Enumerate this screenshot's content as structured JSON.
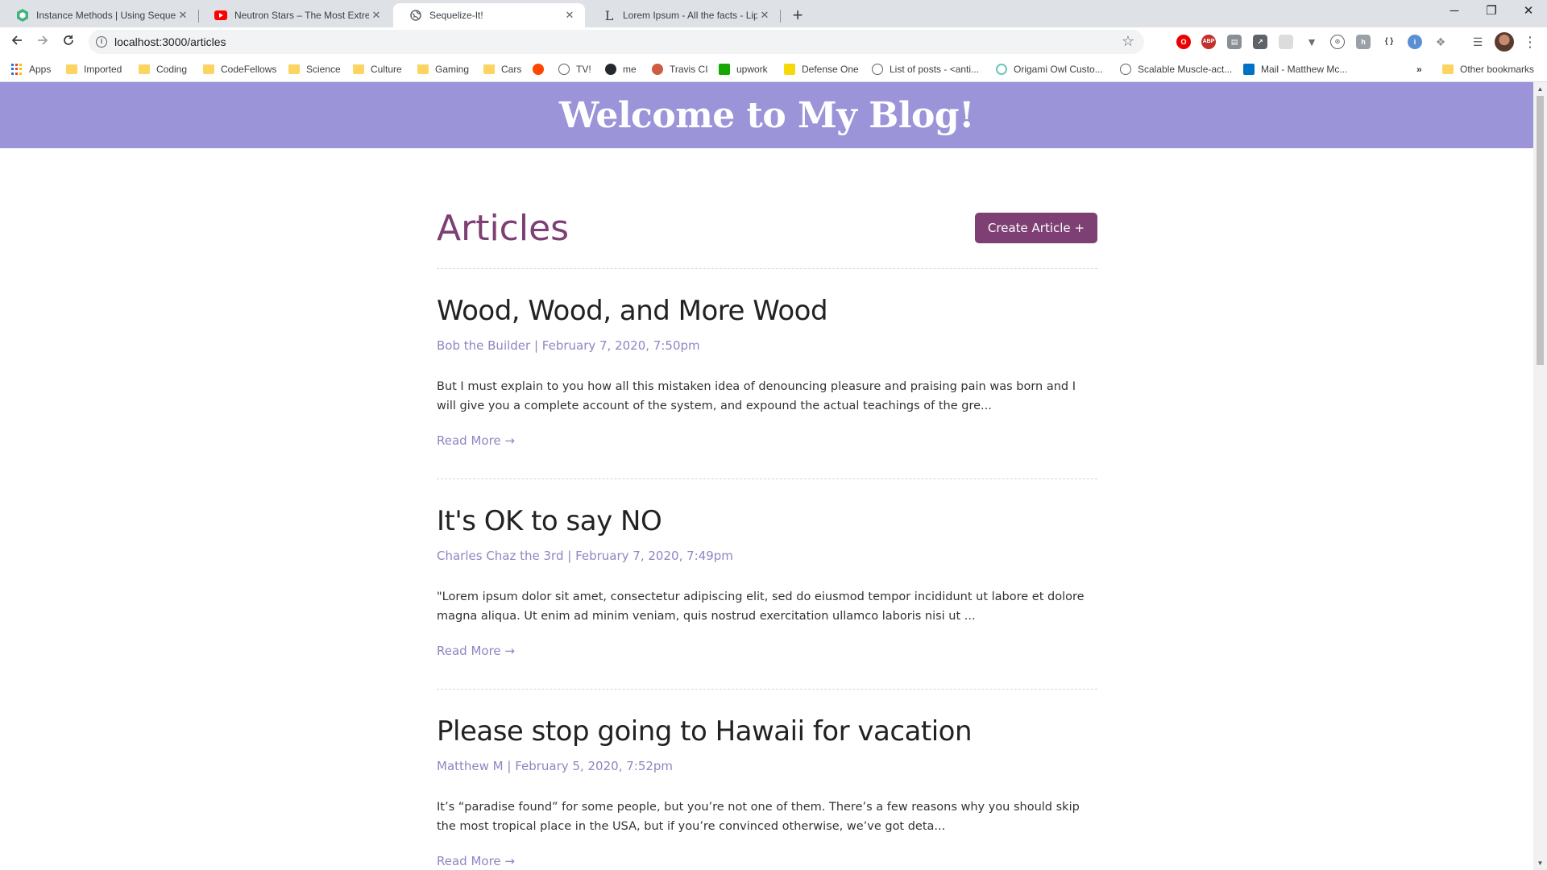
{
  "browser": {
    "tabs": [
      {
        "title": "Instance Methods | Using Sequelize",
        "icon": "sequelize-icon",
        "color": "#3fb37f"
      },
      {
        "title": "Neutron Stars – The Most Extreme",
        "icon": "youtube-icon",
        "color": "#ff0000"
      },
      {
        "title": "Sequelize-It!",
        "icon": "globe-icon",
        "color": "#5f6368"
      },
      {
        "title": "Lorem Ipsum - All the facts - Lipsum",
        "icon": "lipsum-icon",
        "color": "#202124"
      }
    ],
    "active_tab": 2,
    "url": "localhost:3000/articles",
    "bookmarks": [
      {
        "label": "Apps",
        "icon": "apps-grid-icon"
      },
      {
        "label": "Imported",
        "icon": "folder-icon"
      },
      {
        "label": "Coding",
        "icon": "folder-icon"
      },
      {
        "label": "CodeFellows",
        "icon": "folder-icon"
      },
      {
        "label": "Science",
        "icon": "folder-icon"
      },
      {
        "label": "Culture",
        "icon": "folder-icon"
      },
      {
        "label": "Gaming",
        "icon": "folder-icon"
      },
      {
        "label": "Cars",
        "icon": "folder-icon"
      },
      {
        "label": "",
        "icon": "reddit-icon"
      },
      {
        "label": "TV!",
        "icon": "globe-icon"
      },
      {
        "label": "me",
        "icon": "github-icon"
      },
      {
        "label": "Travis CI",
        "icon": "travis-icon"
      },
      {
        "label": "upwork",
        "icon": "upwork-icon"
      },
      {
        "label": "Defense One",
        "icon": "defense-one-icon"
      },
      {
        "label": "List of posts - <anti...",
        "icon": "globe-icon"
      },
      {
        "label": "Origami Owl Custo...",
        "icon": "origami-owl-icon"
      },
      {
        "label": "Scalable Muscle-act...",
        "icon": "globe-icon"
      },
      {
        "label": "Mail - Matthew Mc...",
        "icon": "outlook-icon"
      }
    ],
    "overflow_label": "»",
    "other_bookmarks": "Other bookmarks"
  },
  "site": {
    "banner_title": "Welcome to My Blog!",
    "page_title": "Articles",
    "create_button": "Create Article +",
    "accent_color": "#7d3f74",
    "banner_color": "#9b94d9"
  },
  "articles": [
    {
      "title": "Wood, Wood, and More Wood",
      "meta": "Bob the Builder | February 7, 2020, 7:50pm",
      "excerpt": "But I must explain to you how all this mistaken idea of denouncing pleasure and praising pain was born and I will give you a complete account of the system, and expound the actual teachings of the gre...",
      "read_more": "Read More →"
    },
    {
      "title": "It's OK to say NO",
      "meta": "Charles Chaz the 3rd | February 7, 2020, 7:49pm",
      "excerpt": "\"Lorem ipsum dolor sit amet, consectetur adipiscing elit, sed do eiusmod tempor incididunt ut labore et dolore magna aliqua. Ut enim ad minim veniam, quis nostrud exercitation ullamco laboris nisi ut ...",
      "read_more": "Read More →"
    },
    {
      "title": "Please stop going to Hawaii for vacation",
      "meta": "Matthew M | February 5, 2020, 7:52pm",
      "excerpt": "It’s “paradise found” for some people, but you’re not one of them. There’s a few reasons why you should skip the most tropical place in the USA, but if you’re convinced otherwise, we’ve got deta...",
      "read_more": "Read More →"
    }
  ]
}
